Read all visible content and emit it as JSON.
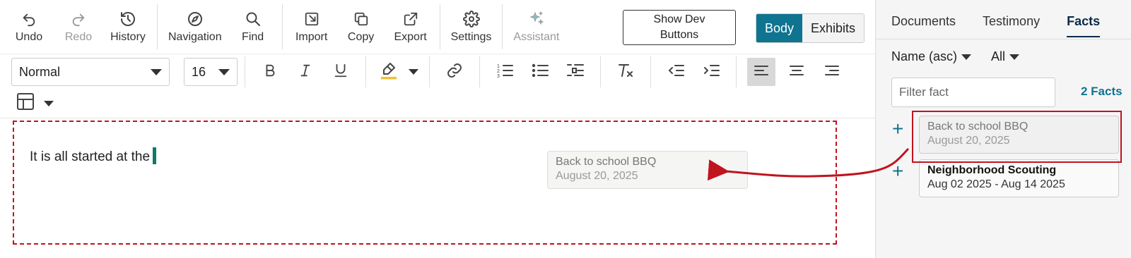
{
  "toolbar": {
    "buttons": [
      {
        "label": "Undo",
        "icon": "undo-icon"
      },
      {
        "label": "Redo",
        "icon": "redo-icon",
        "disabled": true
      },
      {
        "label": "History",
        "icon": "history-icon"
      },
      {
        "label": "Navigation",
        "icon": "compass-icon"
      },
      {
        "label": "Find",
        "icon": "search-icon"
      },
      {
        "label": "Import",
        "icon": "import-icon"
      },
      {
        "label": "Copy",
        "icon": "copy-icon"
      },
      {
        "label": "Export",
        "icon": "export-icon"
      },
      {
        "label": "Settings",
        "icon": "gear-icon"
      },
      {
        "label": "Assistant",
        "icon": "sparkle-icon",
        "disabled": true
      }
    ],
    "show_dev_buttons": "Show Dev Buttons",
    "view_toggle": {
      "body": "Body",
      "exhibits": "Exhibits",
      "selected": "Body"
    }
  },
  "format": {
    "style": "Normal",
    "size": "16",
    "highlight_color": "#f2c12e",
    "active_alignment": "align-left"
  },
  "editor": {
    "text": "It is all started at the",
    "drag_ghost": {
      "title": "Back to school BBQ",
      "date": "August 20, 2025"
    }
  },
  "panel": {
    "tabs": [
      "Documents",
      "Testimony",
      "Facts"
    ],
    "active_tab": "Facts",
    "sort": "Name (asc)",
    "filter_scope": "All",
    "filter_placeholder": "Filter fact",
    "count": "2 Facts",
    "facts": [
      {
        "title": "Back to school BBQ",
        "date": "August 20, 2025",
        "state": "dragging"
      },
      {
        "title": "Neighborhood Scouting",
        "date": "Aug 02 2025 - Aug 14 2025",
        "state": "normal"
      }
    ]
  },
  "colors": {
    "accent": "#0e7490",
    "annotation": "#c0141f",
    "caret": "#0d7a6a"
  }
}
